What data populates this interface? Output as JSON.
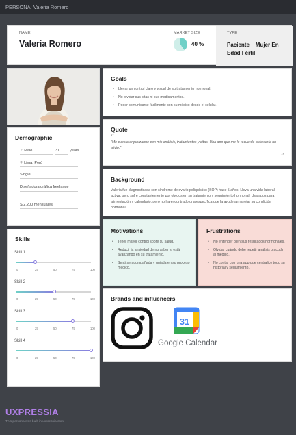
{
  "topbar": {
    "text": "PERSONA: Valeria Romero"
  },
  "header": {
    "name_label": "NAME",
    "name": "Valeria Romero",
    "market_label": "MARKET SIZE",
    "market_pct_text": "40 %",
    "market_fraction": 0.4,
    "type_label": "TYPE",
    "type_value": "Paciente – Mujer En Edad Fértil"
  },
  "demographic": {
    "title": "Demographic",
    "gender": "Male",
    "age": "31",
    "age_unit": "years",
    "location": "Lima, Perú",
    "status": "Single",
    "occupation": "Diseñadora gráfica freelance",
    "income": "S/2,200 mensuales"
  },
  "skills": {
    "title": "Skills",
    "ticks": [
      "0",
      "25",
      "50",
      "75",
      "100"
    ],
    "items": [
      {
        "name": "Skill 1",
        "value": 25
      },
      {
        "name": "Skill 2",
        "value": 50
      },
      {
        "name": "Skill 3",
        "value": 75
      },
      {
        "name": "Skill 4",
        "value": 100
      }
    ]
  },
  "goals": {
    "title": "Goals",
    "items": [
      "Llevar un control claro y visual de su tratamiento hormonal.",
      "No olvidar sus citas ni sus medicamentos.",
      "Poder comunicarse fácilmente con su médico desde el celular."
    ]
  },
  "quote": {
    "title": "Quote",
    "open_mark": "“",
    "close_mark": "”",
    "text": "\"Me cuesta organizarme con mis análisis, tratamientos y citas. Una app que me lo recuerde todo sería un alivio.\""
  },
  "background": {
    "title": "Background",
    "text": "Valeria fue diagnosticada con síndrome de ovario poliquístico (SOP) hace 5 años. Lleva una vida laboral activa, pero sufre constantemente por olvidos en su tratamiento y seguimiento hormonal. Usa apps para alimentación y calendario, pero no ha encontrado una específica que la ayude a manejar su condición hormonal."
  },
  "motivations": {
    "title": "Motivations",
    "items": [
      "Tener mayor control sobre su salud.",
      "Reducir la ansiedad de no saber si está avanzando en su tratamiento.",
      "Sentirse acompañada y guiada en su proceso médico."
    ]
  },
  "frustrations": {
    "title": "Frustrations",
    "items": [
      "No entender bien sus resultados hormonales.",
      "Olvidar cuándo debe repetir análisis o acudir al médico.",
      "No contar con una app que centralice todo su historial y seguimiento."
    ]
  },
  "brands": {
    "title": "Brands and influencers",
    "items": [
      {
        "name": "Instagram",
        "icon": "instagram-icon"
      },
      {
        "name": "Google Calendar",
        "icon": "google-calendar-icon",
        "label": "Google Calendar",
        "day": "31"
      }
    ]
  },
  "footer": {
    "logo": "UXPRESSIA",
    "note": "This persona was built in uxpressia.com"
  },
  "colors": {
    "accent": "#6fd0c7",
    "accent2": "#8a7fe0",
    "motivations_bg": "#e8f5f1",
    "frustrations_bg": "#f9dcd7",
    "logo": "#b07fe6"
  }
}
